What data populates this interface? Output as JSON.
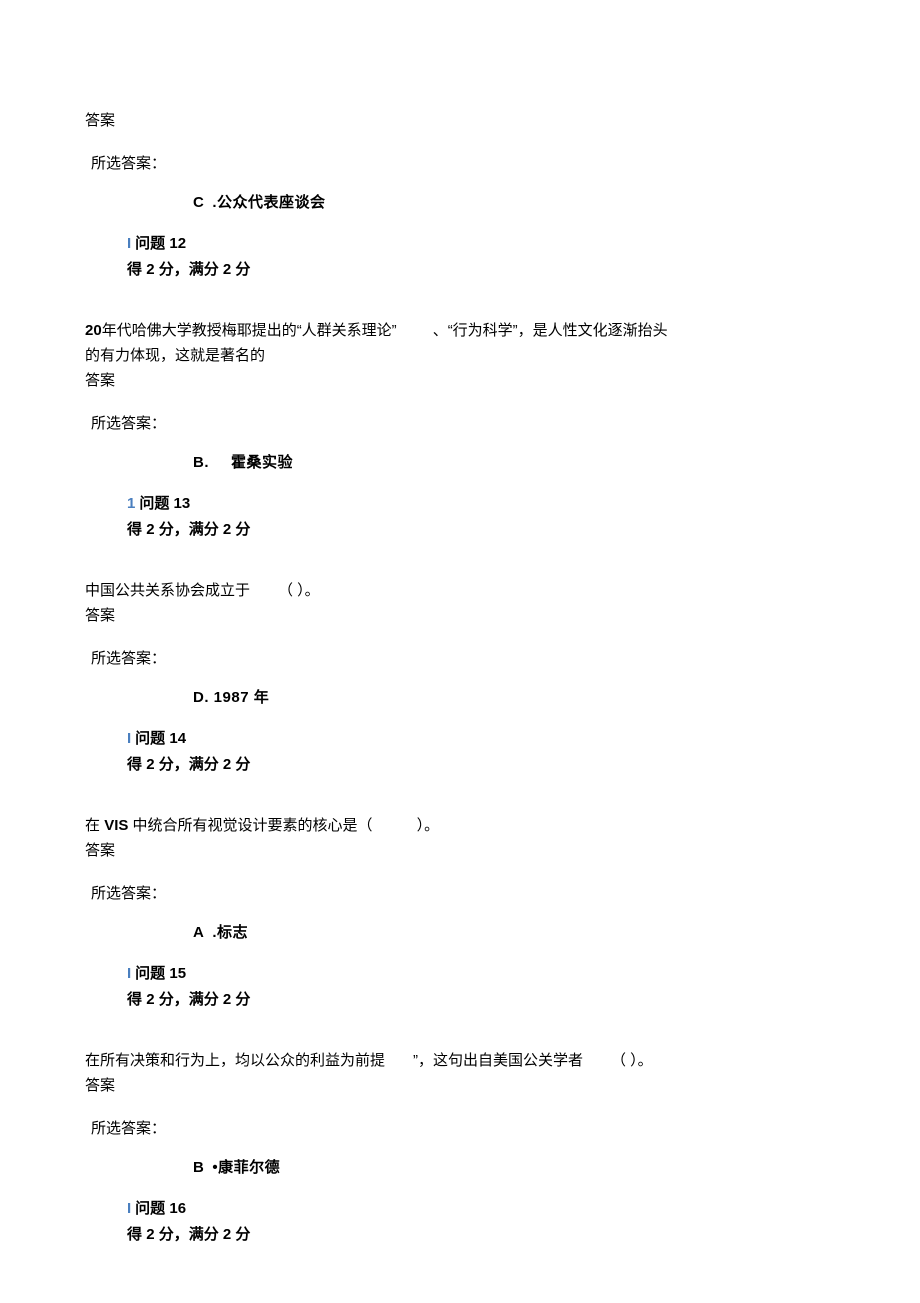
{
  "labels": {
    "answer": "答案",
    "selected": "所选答案：",
    "question_prefix": "问题",
    "score_prefix": "得",
    "score_mid": "分，满分",
    "score_suffix": "分"
  },
  "q11": {
    "answer_letter": "C",
    "answer_text": ".公众代表座谈会"
  },
  "q12": {
    "number": "12",
    "score_got": "2",
    "score_full": "2",
    "text_line1a": "20",
    "text_line1b": "年代哈佛大学教授梅耶提出的“人群关系理论”",
    "text_line1c": "、“行为科学”，是人性文化逐渐抬头",
    "text_line2": "的有力体现，这就是著名的",
    "answer_letter": "B.",
    "answer_text": "霍桑实验"
  },
  "q13": {
    "number": "13",
    "bar": "1",
    "score_got": "2",
    "score_full": "2",
    "text": "中国公共关系协会成立于",
    "paren": "（ ）。",
    "answer_letter": "D",
    "answer_text": ". 1987",
    "answer_suffix": "年"
  },
  "q14": {
    "number": "14",
    "score_got": "2",
    "score_full": "2",
    "text_a": "在",
    "text_b": "VIS",
    "text_c": "中统合所有视觉设计要素的核心是（",
    "text_d": "）。",
    "answer_letter": "A",
    "answer_text": ".标志"
  },
  "q15": {
    "number": "15",
    "score_got": "2",
    "score_full": "2",
    "text_a": " 在所有决策和行为上，均以公众的利益为前提",
    "text_b": "”，这句出自美国公关学者",
    "text_c": "（ ）。",
    "answer_letter": "B",
    "answer_text": "•康菲尔德"
  },
  "q16": {
    "number": "16",
    "score_got": "2",
    "score_full": "2"
  }
}
